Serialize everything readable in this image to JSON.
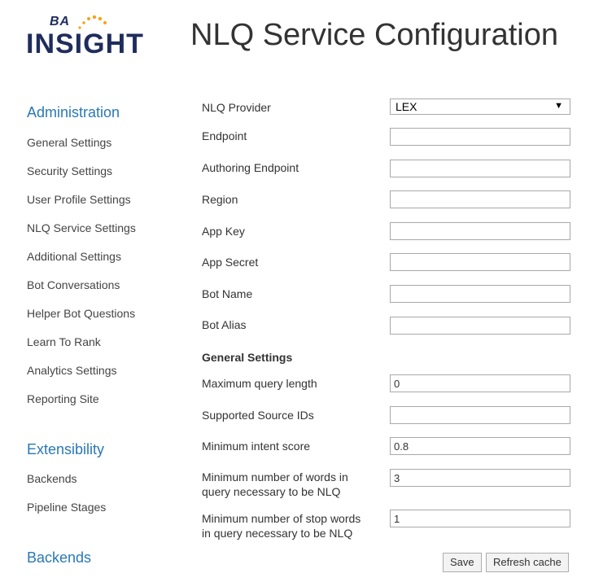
{
  "header": {
    "logo_ba": "BA",
    "logo_insight": "INSIGHT",
    "title": "NLQ Service Configuration"
  },
  "sidebar": {
    "administration_heading": "Administration",
    "administration_items": [
      {
        "label": "General Settings"
      },
      {
        "label": "Security Settings"
      },
      {
        "label": "User Profile Settings"
      },
      {
        "label": "NLQ Service Settings"
      },
      {
        "label": "Additional Settings"
      },
      {
        "label": "Bot Conversations"
      },
      {
        "label": "Helper Bot Questions"
      },
      {
        "label": "Learn To Rank"
      },
      {
        "label": "Analytics Settings"
      },
      {
        "label": "Reporting Site"
      }
    ],
    "extensibility_heading": "Extensibility",
    "extensibility_items": [
      {
        "label": "Backends"
      },
      {
        "label": "Pipeline Stages"
      }
    ],
    "backends_heading": "Backends"
  },
  "form": {
    "nlq_provider": {
      "label": "NLQ Provider",
      "value": "LEX"
    },
    "endpoint": {
      "label": "Endpoint",
      "value": ""
    },
    "authoring_endpoint": {
      "label": "Authoring Endpoint",
      "value": ""
    },
    "region": {
      "label": "Region",
      "value": ""
    },
    "app_key": {
      "label": "App Key",
      "value": ""
    },
    "app_secret": {
      "label": "App Secret",
      "value": ""
    },
    "bot_name": {
      "label": "Bot Name",
      "value": ""
    },
    "bot_alias": {
      "label": "Bot Alias",
      "value": ""
    },
    "general_settings_heading": "General Settings",
    "max_query_length": {
      "label": "Maximum query length",
      "value": "0"
    },
    "supported_source_ids": {
      "label": "Supported Source IDs",
      "value": ""
    },
    "min_intent_score": {
      "label": "Minimum intent score",
      "value": "0.8"
    },
    "min_words": {
      "label_line1": "Minimum number of words in",
      "label_line2": "query necessary to be NLQ",
      "value": "3"
    },
    "min_stop_words": {
      "label_line1": "Minimum number of stop words",
      "label_line2": "in query necessary to be NLQ",
      "value": "1"
    }
  },
  "buttons": {
    "save": "Save",
    "refresh_cache": "Refresh cache"
  },
  "colors": {
    "brand_navy": "#1f2d5c",
    "brand_orange": "#f5a21b",
    "link_blue": "#2a78b5"
  },
  "icons": {
    "dropdown": "chevron-down-icon",
    "logo_dots": "dots-icon"
  }
}
